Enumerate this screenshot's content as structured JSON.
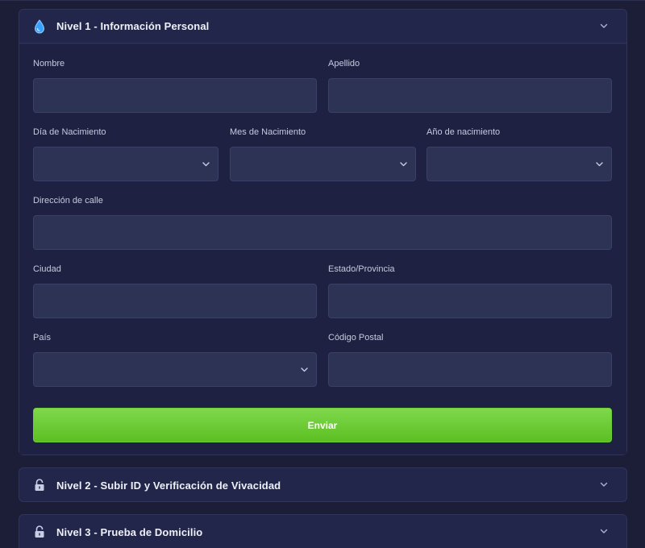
{
  "levels": [
    {
      "title": "Nivel 1 - Información Personal",
      "icon": "water-drop-icon",
      "expanded": true
    },
    {
      "title": "Nivel 2 - Subir ID y Verificación de Vivacidad",
      "icon": "unlock-icon",
      "expanded": false
    },
    {
      "title": "Nivel 3 - Prueba de Domicilio",
      "icon": "unlock-icon",
      "expanded": false
    }
  ],
  "form": {
    "first_name": {
      "label": "Nombre",
      "value": ""
    },
    "last_name": {
      "label": "Apellido",
      "value": ""
    },
    "birth_day": {
      "label": "Día de Nacimiento",
      "value": ""
    },
    "birth_month": {
      "label": "Mes de Nacimiento",
      "value": ""
    },
    "birth_year": {
      "label": "Año de nacimiento",
      "value": ""
    },
    "street": {
      "label": "Dirección de calle",
      "value": ""
    },
    "city": {
      "label": "Ciudad",
      "value": ""
    },
    "state": {
      "label": "Estado/Provincia",
      "value": ""
    },
    "country": {
      "label": "País",
      "value": ""
    },
    "postal_code": {
      "label": "Código Postal",
      "value": ""
    },
    "submit_label": "Enviar"
  },
  "colors": {
    "background": "#1b1e36",
    "panel": "#22264a",
    "field": "#2c3354",
    "accent_green": "#66c72c",
    "drop_blue": "#3aa0ff"
  }
}
